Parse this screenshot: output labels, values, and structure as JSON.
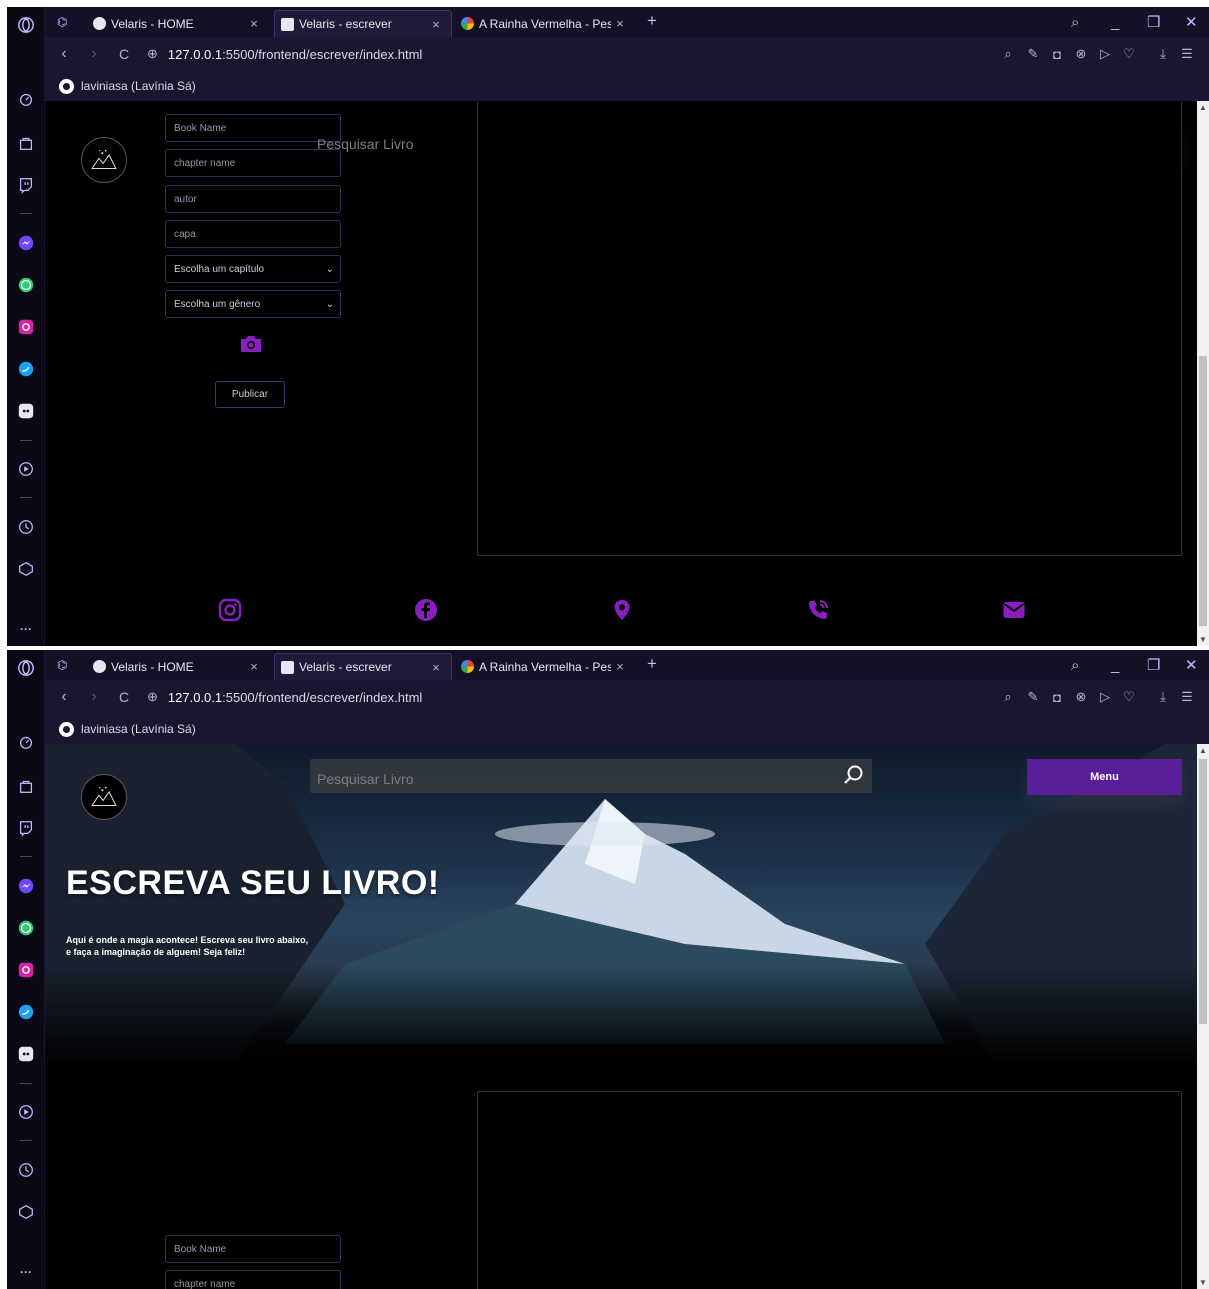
{
  "browser": {
    "tabs": [
      {
        "label": "Velaris - HOME",
        "close": "×"
      },
      {
        "label": "Velaris - escrever",
        "close": "×"
      },
      {
        "label": "A Rainha Vermelha - Pesqu",
        "close": "×"
      }
    ],
    "new_tab": "+",
    "url": {
      "host": "127.0.0.1",
      "path": ":5500/frontend/escrever/index.html"
    },
    "bookmark": "laviniasa (Lavínia Sá)",
    "nav": {
      "back": "‹",
      "forward": "›",
      "reload": "C"
    },
    "window": {
      "search": "⌕",
      "minimize": "_",
      "maximize": "❐",
      "close": "✕"
    },
    "sidebar_icons": [
      "opera-logo",
      "speed-dial-icon",
      "shopping-bag-icon",
      "twitch-icon",
      "messenger-icon",
      "whatsapp-icon",
      "instagram-icon",
      "twitter-icon",
      "discord-icon",
      "player-icon",
      "history-icon",
      "extensions-icon",
      "more-icon"
    ],
    "more": "···"
  },
  "form": {
    "book_name": "Book Name",
    "chapter_name": "chapter name",
    "autor": "autor",
    "capa": "capa",
    "chapter_select": "Escolha um capítulo",
    "genre_select": "Escolha um gênero",
    "publish": "Publicar"
  },
  "search": {
    "placeholder": "Pesquisar Livro"
  },
  "menu": {
    "label": "Menu"
  },
  "hero": {
    "title": "ESCREVA SEU LIVRO!",
    "subtitle_line1": "Aqui é onde a magia acontece! Escreva seu livro abaixo,",
    "subtitle_line2": "e faça a imaginação de alguem! Seja feliz!"
  },
  "footer": {
    "icons": [
      "instagram-icon",
      "facebook-icon",
      "location-icon",
      "phone-icon",
      "email-icon"
    ]
  },
  "colors": {
    "accent": "#5b1e9a",
    "icon_purple": "#8a1fbf",
    "border": "#3b2a5c",
    "chrome": "#141025"
  }
}
